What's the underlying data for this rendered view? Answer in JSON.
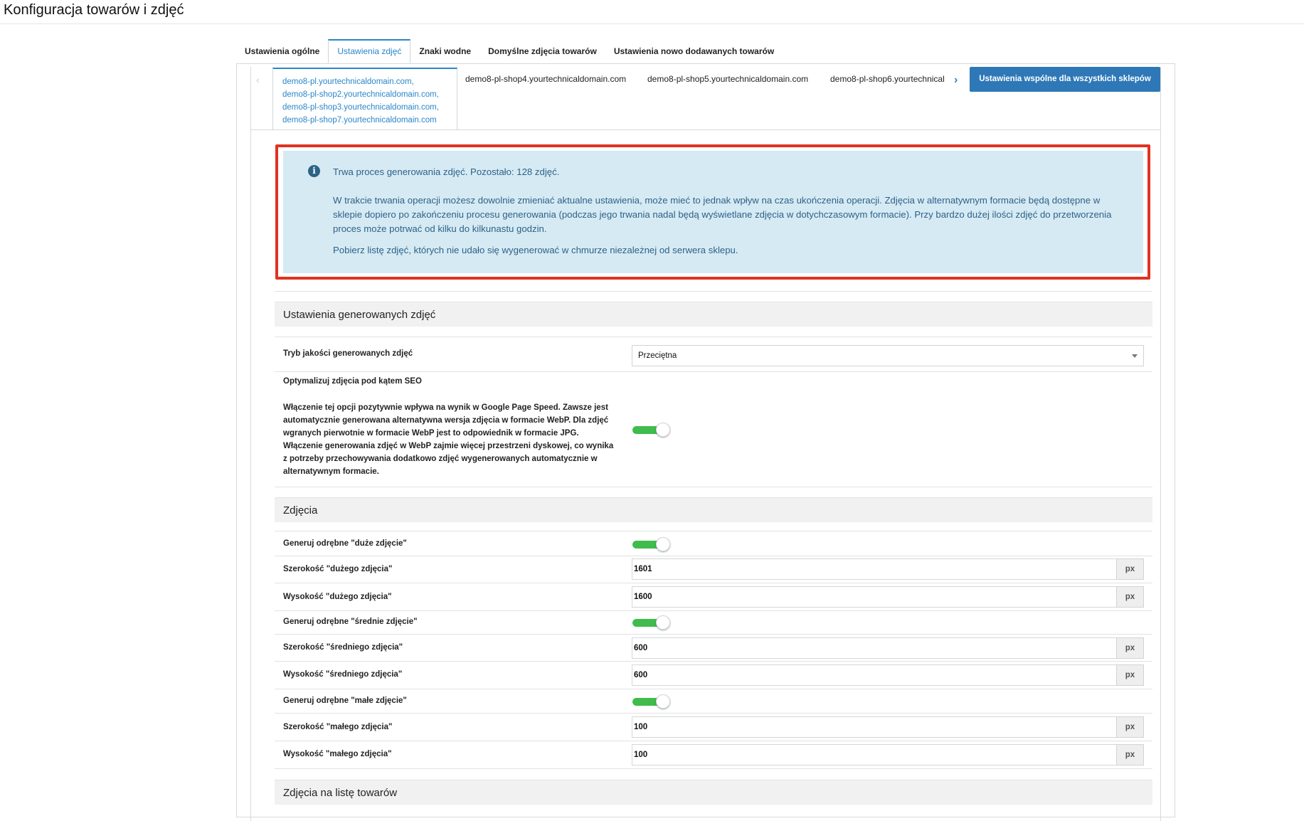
{
  "page": {
    "title": "Konfiguracja towarów i zdjęć"
  },
  "main_tabs": [
    {
      "label": "Ustawienia ogólne",
      "active": false
    },
    {
      "label": "Ustawienia zdjęć",
      "active": true
    },
    {
      "label": "Znaki wodne",
      "active": false
    },
    {
      "label": "Domyślne zdjęcia towarów",
      "active": false
    },
    {
      "label": "Ustawienia nowo dodawanych towarów",
      "active": false
    }
  ],
  "shop_tabs": {
    "prev_icon": "chevron-left-icon",
    "active_group": [
      "demo8-pl.yourtechnicaldomain.com,",
      "demo8-pl-shop2.yourtechnicaldomain.com,",
      "demo8-pl-shop3.yourtechnicaldomain.com,",
      "demo8-pl-shop7.yourtechnicaldomain.com"
    ],
    "tabs": [
      "demo8-pl-shop4.yourtechnicaldomain.com",
      "demo8-pl-shop5.yourtechnicaldomain.com",
      "demo8-pl-shop6.yourtechnical"
    ],
    "next_icon": "chevron-right-icon",
    "shared_button": "Ustawienia wspólne dla wszystkich sklepów"
  },
  "alert": {
    "title": "Trwa proces generowania zdjęć. Pozostało: 128 zdjęć.",
    "body": "W trakcie trwania operacji możesz dowolnie zmieniać aktualne ustawienia, może mieć to jednak wpływ na czas ukończenia operacji. Zdjęcia w alternatywnym formacie będą dostępne w sklepie dopiero po zakończeniu procesu generowania (podczas jego trwania nadal będą wyświetlane zdjęcia w dotychczasowym formacie). Przy bardzo dużej ilości zdjęć do przetworzenia proces może potrwać od kilku do kilkunastu godzin.",
    "link": "Pobierz listę zdjęć, których nie udało się wygenerować w chmurze niezależnej od serwera sklepu.",
    "highlight_color": "#e13222"
  },
  "generated_settings": {
    "header": "Ustawienia generowanych zdjęć",
    "quality_label": "Tryb jakości generowanych zdjęć",
    "quality_value": "Przeciętna",
    "seo_label": "Optymalizuj zdjęcia pod kątem SEO",
    "seo_description": "Włączenie tej opcji pozytywnie wpływa na wynik w Google Page Speed. Zawsze jest automatycznie generowana alternatywna wersja zdjęcia w formacie WebP. Dla zdjęć wgranych pierwotnie w formacie WebP jest to odpowiednik w formacie JPG. Włączenie generowania zdjęć w WebP zajmie więcej przestrzeni dyskowej, co wynika z potrzeby przechowywania dodatkowo zdjęć wygenerowanych automatycznie w alternatywnym formacie.",
    "seo_enabled": true
  },
  "photos": {
    "header": "Zdjęcia",
    "unit": "px",
    "rows": [
      {
        "label": "Generuj odrębne \"duże zdjęcie\"",
        "enabled": true
      },
      {
        "label": "Szerokość \"dużego zdjęcia\"",
        "value": "1601"
      },
      {
        "label": "Wysokość \"dużego zdjęcia\"",
        "value": "1600"
      },
      {
        "label": "Generuj odrębne \"średnie zdjęcie\"",
        "enabled": true
      },
      {
        "label": "Szerokość \"średniego zdjęcia\"",
        "value": "600"
      },
      {
        "label": "Wysokość \"średniego zdjęcia\"",
        "value": "600"
      },
      {
        "label": "Generuj odrębne \"małe zdjęcie\"",
        "enabled": true
      },
      {
        "label": "Szerokość \"małego zdjęcia\"",
        "value": "100"
      },
      {
        "label": "Wysokość \"małego zdjęcia\"",
        "value": "100"
      }
    ]
  },
  "list_photos": {
    "header": "Zdjęcia na listę towarów"
  },
  "colors": {
    "accent": "#2a86c8",
    "toggle_on": "#3fbc4b",
    "alert_bg": "#d6eaf4",
    "alert_text": "#2d6287"
  }
}
